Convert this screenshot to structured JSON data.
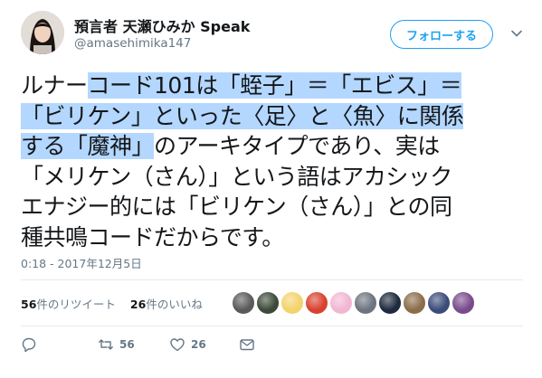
{
  "author": {
    "display_name": "預言者 天瀬ひみか Speak",
    "handle": "@amasehimika147"
  },
  "follow_button": {
    "label": "フォローする"
  },
  "tweet": {
    "lines": [
      [
        {
          "t": "ルナー",
          "hl": false
        },
        {
          "t": "コード101は「蛭子」＝「エビス」＝",
          "hl": true
        }
      ],
      [
        {
          "t": "「ビリケン」といった〈足〉と〈魚〉に関係",
          "hl": true
        }
      ],
      [
        {
          "t": "する「魔神」",
          "hl": true
        },
        {
          "t": "のアーキタイプであり、実は",
          "hl": false
        }
      ],
      [
        {
          "t": "「メリケン（さん）」という語はアカシック",
          "hl": false
        }
      ],
      [
        {
          "t": "エナジー的には「ビリケン（さん）」との同",
          "hl": false
        }
      ],
      [
        {
          "t": "種共鳴コードだからです。",
          "hl": false
        }
      ]
    ],
    "timestamp": "0:18 - 2017年12月5日"
  },
  "stats": {
    "retweets_count": "56",
    "retweets_label": "件のリツイート",
    "likes_count": "26",
    "likes_label": "件のいいね"
  },
  "liker_avatars": [
    {
      "name": "liker-avatar-1",
      "color": "#5a5a5a"
    },
    {
      "name": "liker-avatar-2",
      "color": "#3d4a3a"
    },
    {
      "name": "liker-avatar-3",
      "color": "#f3d36b"
    },
    {
      "name": "liker-avatar-4",
      "color": "#d9412e"
    },
    {
      "name": "liker-avatar-5",
      "color": "#f2b6d3"
    },
    {
      "name": "liker-avatar-6",
      "color": "#6d7480"
    },
    {
      "name": "liker-avatar-7",
      "color": "#1e2a3e"
    },
    {
      "name": "liker-avatar-8",
      "color": "#8b6e4a"
    },
    {
      "name": "liker-avatar-9",
      "color": "#3b4c7a"
    },
    {
      "name": "liker-avatar-10",
      "color": "#7a4b8c"
    }
  ],
  "actions": {
    "reply_count": "",
    "retweet_count": "56",
    "like_count": "26"
  },
  "colors": {
    "accent": "#1da1f2",
    "secondary_text": "#657786",
    "highlight": "#b3d7ff"
  }
}
